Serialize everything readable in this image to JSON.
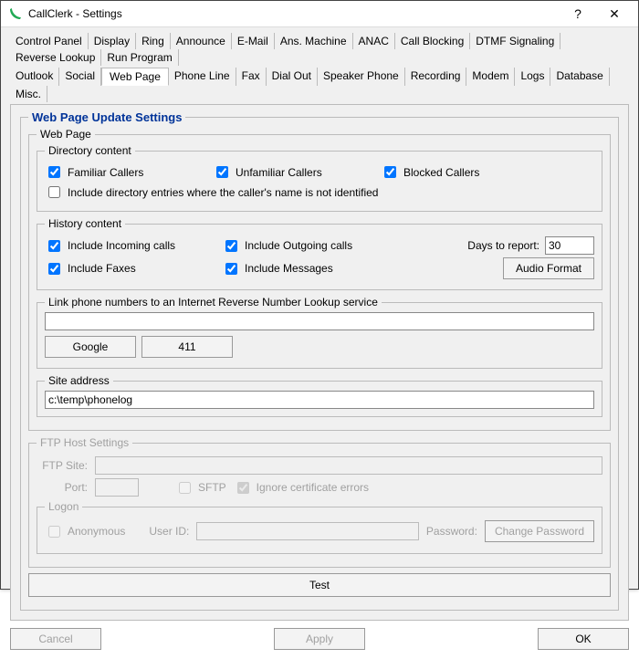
{
  "window": {
    "title": "CallClerk - Settings",
    "help": "?",
    "close": "✕"
  },
  "tabs_row1": [
    "Control Panel",
    "Display",
    "Ring",
    "Announce",
    "E-Mail",
    "Ans. Machine",
    "ANAC",
    "Call Blocking",
    "DTMF Signaling",
    "Reverse Lookup",
    "Run Program"
  ],
  "tabs_row2": [
    "Outlook",
    "Social",
    "Web Page",
    "Phone Line",
    "Fax",
    "Dial Out",
    "Speaker Phone",
    "Recording",
    "Modem",
    "Logs",
    "Database",
    "Misc."
  ],
  "active_tab": "Web Page",
  "section_title": "Web Page Update Settings",
  "webpage": {
    "legend": "Web Page",
    "directory_legend": "Directory content",
    "cb_familiar": {
      "label": "Familiar Callers",
      "checked": true
    },
    "cb_unfamiliar": {
      "label": "Unfamiliar Callers",
      "checked": true
    },
    "cb_blocked": {
      "label": "Blocked Callers",
      "checked": true
    },
    "cb_includeunid": {
      "label": "Include directory entries where the caller's name is not identified",
      "checked": false
    },
    "history_legend": "History content",
    "cb_incoming": {
      "label": "Include Incoming calls",
      "checked": true
    },
    "cb_outgoing": {
      "label": "Include Outgoing calls",
      "checked": true
    },
    "cb_faxes": {
      "label": "Include Faxes",
      "checked": true
    },
    "cb_messages": {
      "label": "Include Messages",
      "checked": true
    },
    "days_label": "Days to report:",
    "days_value": "30",
    "audio_format": "Audio Format",
    "reverse_legend": "Link phone numbers to an Internet Reverse Number Lookup service",
    "reverse_value": "",
    "btn_google": "Google",
    "btn_411": "411",
    "site_legend": "Site address",
    "site_value": "c:\\temp\\phonelog"
  },
  "ftp": {
    "legend": "FTP Host Settings",
    "site_label": "FTP Site:",
    "site_value": "",
    "port_label": "Port:",
    "port_value": "",
    "sftp_label": "SFTP",
    "sftp_checked": false,
    "ignore_cert_label": "Ignore certificate errors",
    "ignore_cert_checked": true,
    "logon_legend": "Logon",
    "anon_label": "Anonymous",
    "anon_checked": false,
    "userid_label": "User ID:",
    "userid_value": "",
    "password_label": "Password:",
    "change_pwd": "Change Password"
  },
  "test_btn": "Test",
  "buttons": {
    "cancel": "Cancel",
    "apply": "Apply",
    "ok": "OK"
  }
}
